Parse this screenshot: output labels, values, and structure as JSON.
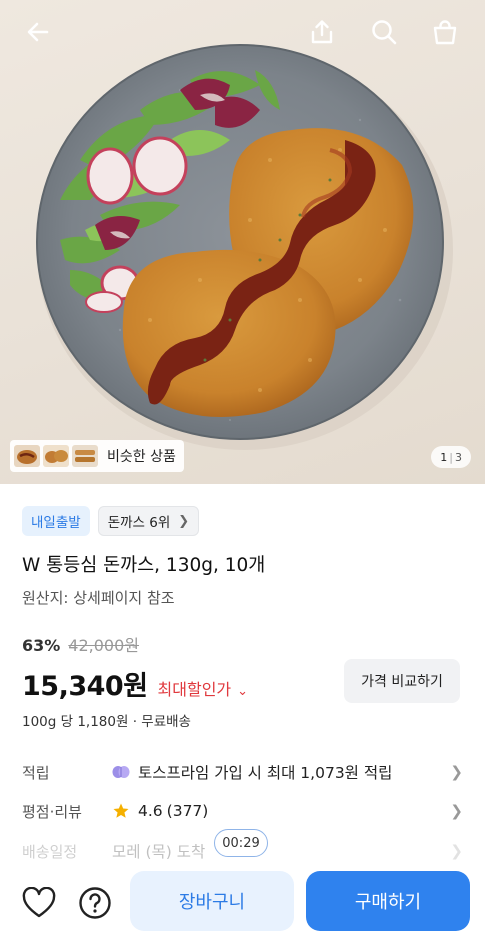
{
  "header": {
    "back_icon": "back-arrow-icon",
    "share_icon": "share-icon",
    "search_icon": "search-icon",
    "cart_icon": "shopping-bag-icon"
  },
  "gallery": {
    "similar_label": "비슷한 상품",
    "current_page": "1",
    "total_pages": "3"
  },
  "product": {
    "badge_delivery": "내일출발",
    "badge_rank": "돈까스 6위",
    "title": "W 통등심 돈까스, 130g, 10개",
    "origin": "원산지: 상세페이지 참조",
    "discount_rate": "63%",
    "original_price": "42,000원",
    "price": "15,340원",
    "max_discount_label": "최대할인가",
    "compare_button": "가격 비교하기",
    "unit_price": "100g 당 1,180원 · 무료배송"
  },
  "details": {
    "points_label": "적립",
    "points_value": "토스프라임 가입 시 최대 1,073원 적립",
    "review_label": "평점·리뷰",
    "rating": "4.6",
    "review_count": "(377)",
    "shipping_label": "배송일정",
    "shipping_value": "모레 (목) 도착"
  },
  "timer": "00:29",
  "bottom_bar": {
    "cart_button": "장바구니",
    "buy_button": "구매하기",
    "heart_icon": "heart-icon",
    "help_icon": "question-icon"
  },
  "colors": {
    "accent_blue": "#2f82ee",
    "light_blue": "#e8f2fe",
    "discount_red": "#e0393e",
    "star": "#f5b000"
  }
}
